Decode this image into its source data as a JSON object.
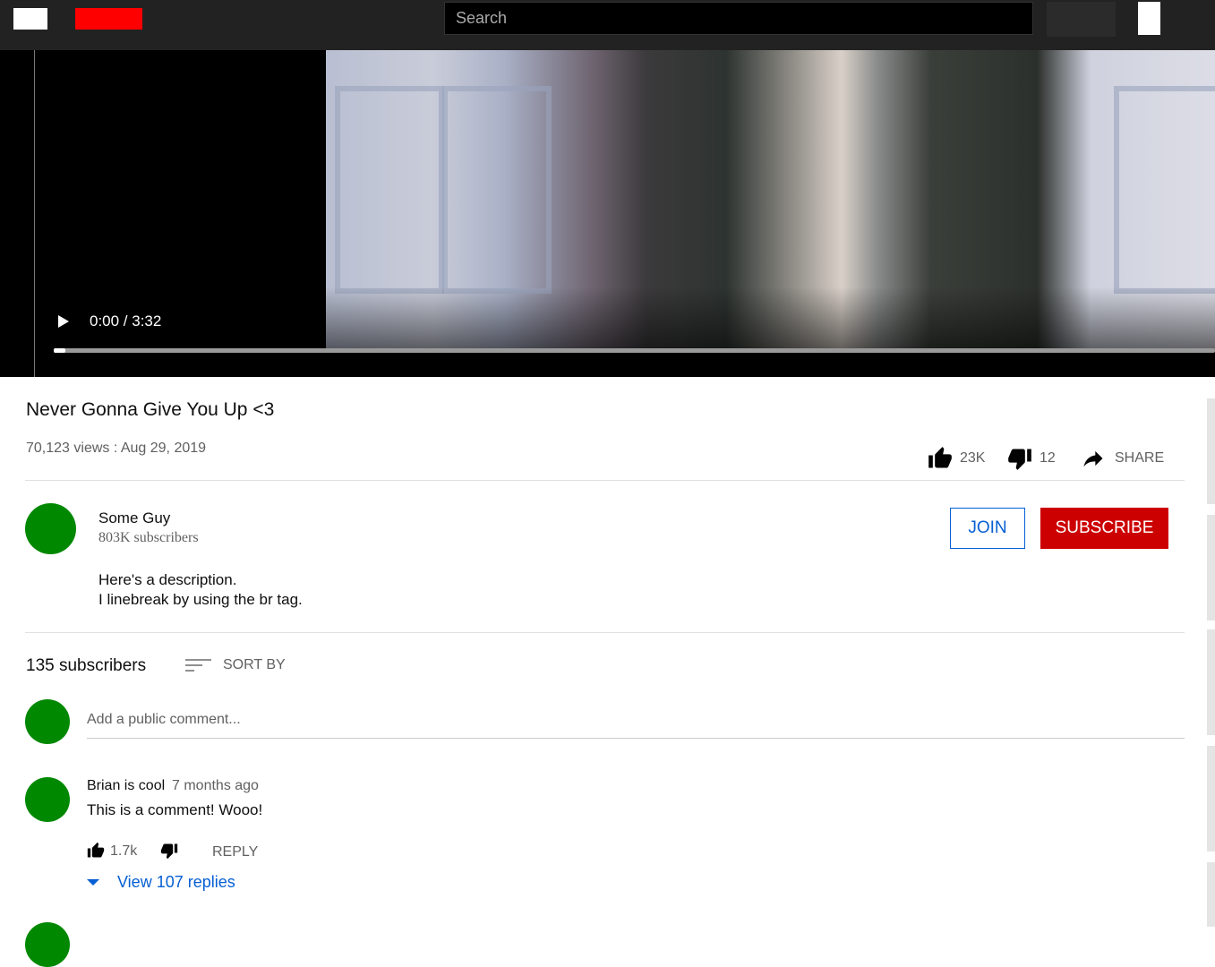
{
  "header": {
    "search_placeholder": "Search"
  },
  "player": {
    "time_display": "0:00 / 3:32",
    "progress": 0.01
  },
  "video": {
    "title": "Never Gonna Give You Up <3",
    "meta": "70,123 views : Aug 29, 2019",
    "likes": "23K",
    "dislikes": "12",
    "share_label": "SHARE"
  },
  "channel": {
    "name": "Some Guy",
    "subscribers": "803K subscribers",
    "join_label": "JOIN",
    "subscribe_label": "SUBSCRIBE",
    "description_line1": "Here's a description.",
    "description_line2": "I linebreak by using the br tag."
  },
  "comments": {
    "count_label": "135 subscribers",
    "sort_label": "SORT BY",
    "input_placeholder": "Add a public comment...",
    "items": [
      {
        "author": "Brian is cool",
        "time": "7 months ago",
        "text": "This is a comment! Wooo!",
        "likes": "1.7k",
        "reply_label": "REPLY",
        "view_replies": "View 107 replies"
      }
    ]
  },
  "colors": {
    "avatar": "#008000",
    "subscribe": "#cc0000",
    "link": "#065fd4",
    "topbar": "#222222"
  }
}
